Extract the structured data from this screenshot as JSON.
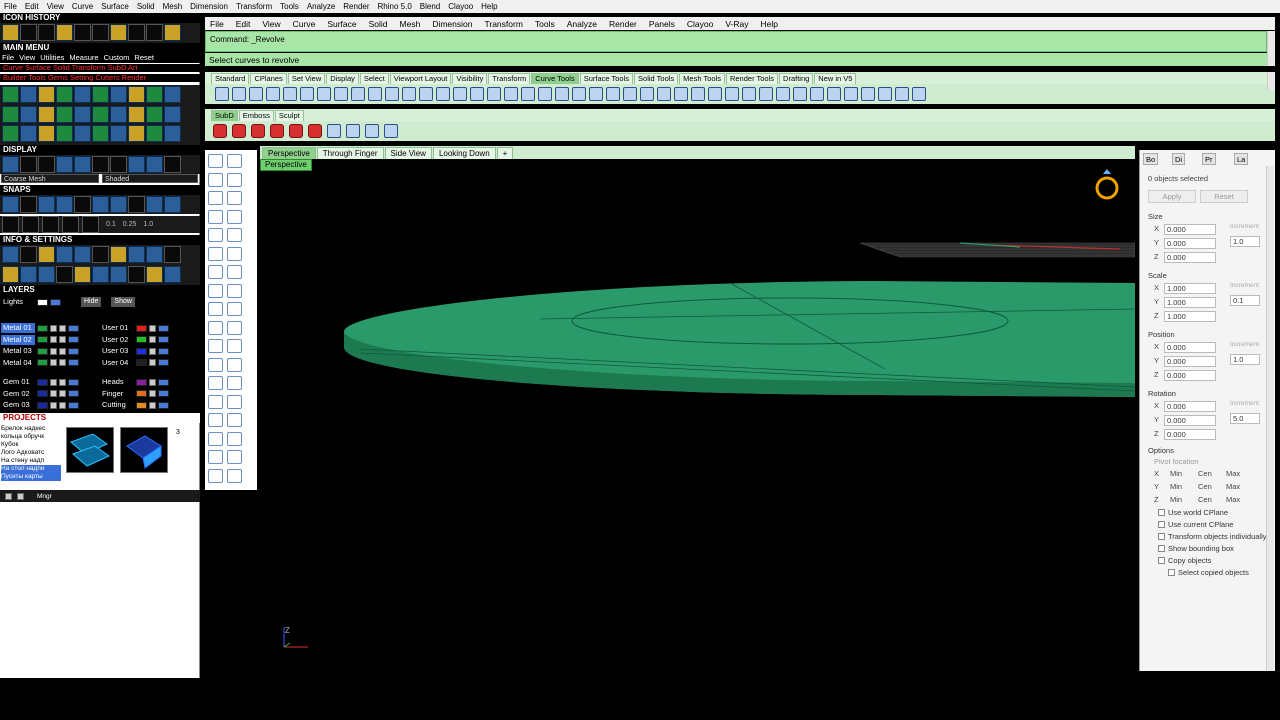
{
  "top_menu": [
    "File",
    "Edit",
    "View",
    "Curve",
    "Surface",
    "Solid",
    "Mesh",
    "Dimension",
    "Transform",
    "Tools",
    "Analyze",
    "Render",
    "Rhino 5.0",
    "Blend",
    "Clayoo",
    "Help"
  ],
  "left_panel": {
    "icon_history_title": "ICON HISTORY",
    "main_menu_title": "MAIN MENU",
    "main_menu_items": [
      "File",
      "View",
      "Utilities",
      "Measure",
      "Custom",
      "Reset"
    ],
    "red_line_1": "Curve Surface Solid Transform SubD Art",
    "red_line_2": "Builder Tools Gems Setting Cutters Render",
    "display_title": "DISPLAY",
    "display_mode_left": "Coarse Mesh",
    "display_mode_right": "Shaded",
    "snaps_title": "SNAPS",
    "snap_values": [
      "0.1",
      "0.25",
      "1.0"
    ],
    "info_title": "INFO & SETTINGS",
    "layers_title": "LAYERS",
    "lights_label": "Lights",
    "hide_label": "Hide",
    "show_label": "Show",
    "layers_left": [
      {
        "name": "Metal 01",
        "color": "#1e9e3e",
        "selected": true
      },
      {
        "name": "Metal 02",
        "color": "#1e9e3e",
        "selected": true
      },
      {
        "name": "Metal 03",
        "color": "#1e9e3e",
        "selected": false
      },
      {
        "name": "Metal 04",
        "color": "#1e9e3e",
        "selected": false
      },
      {
        "name": "Gem 01",
        "color": "#1a2aa0",
        "selected": false
      },
      {
        "name": "Gem 02",
        "color": "#1a2aa0",
        "selected": false
      },
      {
        "name": "Gem 03",
        "color": "#1a2aa0",
        "selected": false
      },
      {
        "name": "Gem 04",
        "color": "#1a2aa0",
        "selected": false
      }
    ],
    "layers_right": [
      {
        "name": "User 01",
        "color": "#e02020"
      },
      {
        "name": "User 02",
        "color": "#20c020"
      },
      {
        "name": "User 03",
        "color": "#2030e0"
      },
      {
        "name": "User 04",
        "color": "#202020"
      },
      {
        "name": "Heads",
        "color": "#8a20a0"
      },
      {
        "name": "Finger",
        "color": "#e07020"
      },
      {
        "name": "Cutting",
        "color": "#e08a20"
      },
      {
        "name": "Creation",
        "color": "#e0a020"
      }
    ],
    "projects_title": "PROJECTS",
    "projects": [
      "Брелок надкес",
      "кольца обручк",
      "Кубок",
      "Лого Адковатс",
      "На стену надп",
      "На стол надпи",
      "Пусеты карты"
    ],
    "projects_highlight": [
      5,
      6
    ],
    "thumb_numbers": [
      "1",
      "2",
      "3"
    ],
    "mngr_label": "Mngr"
  },
  "main_menu": [
    "File",
    "Edit",
    "View",
    "Curve",
    "Surface",
    "Solid",
    "Mesh",
    "Dimension",
    "Transform",
    "Tools",
    "Analyze",
    "Render",
    "Panels",
    "Clayoo",
    "V-Ray",
    "Help"
  ],
  "command": {
    "line": "Command: _Revolve",
    "prompt": "Select curves to revolve"
  },
  "toolbar_tabs": [
    "Standard",
    "CPlanes",
    "Set View",
    "Display",
    "Select",
    "Viewport Layout",
    "Visibility",
    "Transform",
    "Curve Tools",
    "Surface Tools",
    "Solid Tools",
    "Mesh Tools",
    "Render Tools",
    "Drafting",
    "New in V5"
  ],
  "toolbar_tabs_active": 8,
  "toolbar2_tabs": [
    "SubD",
    "Emboss",
    "Sculpt"
  ],
  "toolbar2_tabs_active": 0,
  "viewport_tabs": [
    "Perspective",
    "Through Finger",
    "Side View",
    "Looking Down",
    "+"
  ],
  "viewport_tabs_active": 0,
  "viewport_name": "Perspective",
  "axis_label": "Z",
  "ring_color": "#f0a000",
  "disk_color": "#2a9a6a",
  "properties": {
    "tabs": [
      "Bo",
      "Di",
      "Pr",
      "La"
    ],
    "selection_status": "0 objects selected",
    "apply": "Apply",
    "reset": "Reset",
    "size_title": "Size",
    "size": {
      "x": "0.000",
      "y": "0.000",
      "z": "0.000",
      "incr": "1.0"
    },
    "scale_title": "Scale",
    "scale": {
      "x": "1.000",
      "y": "1.000",
      "z": "1.000",
      "incr": "0.1"
    },
    "position_title": "Position",
    "position": {
      "x": "0.000",
      "y": "0.000",
      "z": "0.000",
      "incr": "1.0"
    },
    "rotation_title": "Rotation",
    "rotation": {
      "x": "0.000",
      "y": "0.000",
      "z": "0.000",
      "incr": "5.0"
    },
    "increment_label": "Increment",
    "options_title": "Options",
    "pivot_label": "Pivot location",
    "pivot_opts": [
      "Min",
      "Cen",
      "Max"
    ],
    "checks": [
      "Use world CPlane",
      "Use current CPlane",
      "Transform objects individually",
      "Show bounding box",
      "Copy objects",
      "Select copied objects"
    ]
  }
}
